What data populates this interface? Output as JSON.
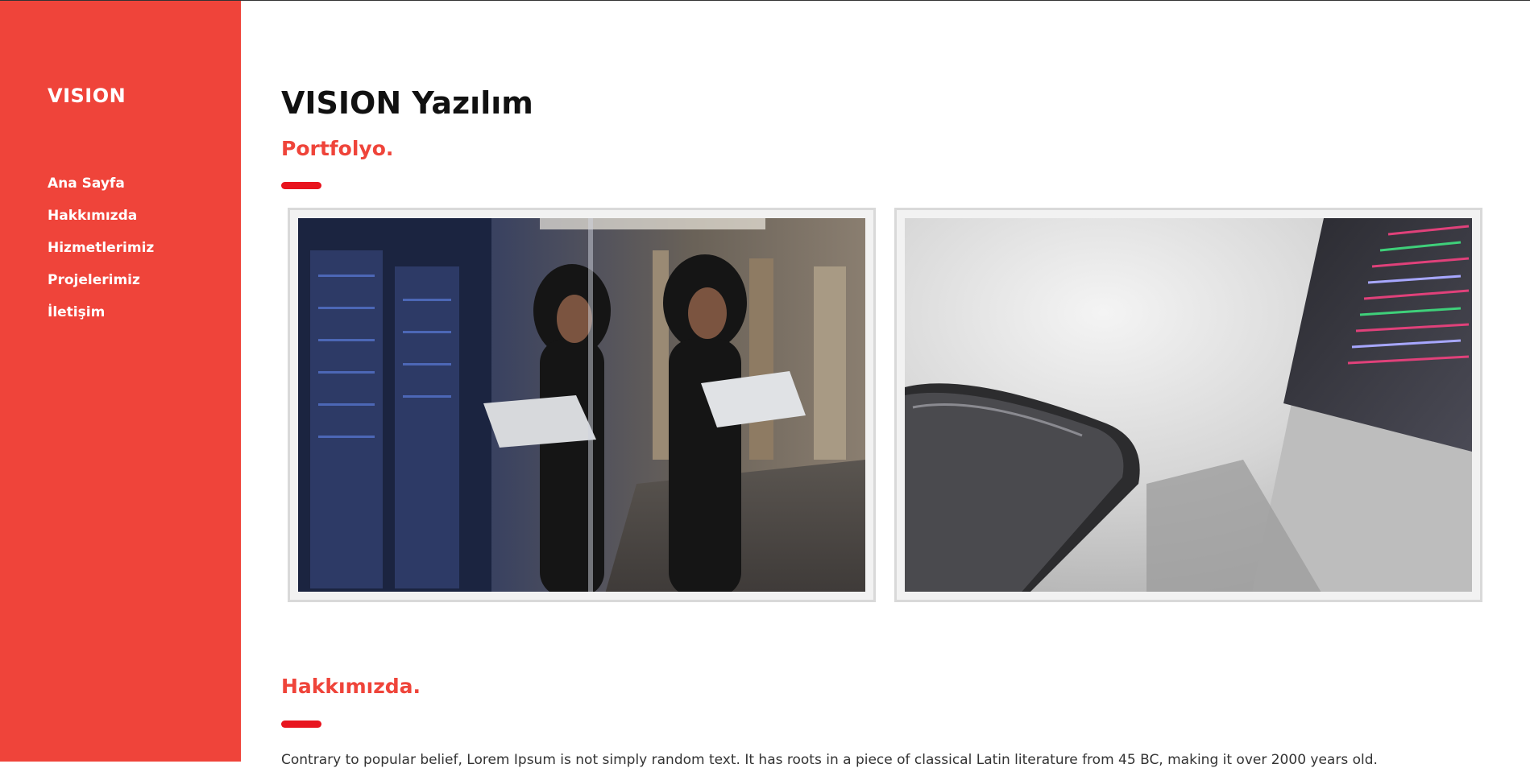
{
  "sidebar": {
    "brand": "VISION",
    "items": [
      {
        "label": "Ana Sayfa"
      },
      {
        "label": "Hakkımızda"
      },
      {
        "label": "Hizmetlerimiz"
      },
      {
        "label": "Projelerimiz"
      },
      {
        "label": "İletişim"
      }
    ]
  },
  "main": {
    "title": "VISION Yazılım",
    "portfolio": {
      "heading": "Portfolyo.",
      "images": [
        "woman-with-laptop-server-room-photo",
        "phone-on-laptop-photo"
      ]
    },
    "about": {
      "heading": "Hakkımızda.",
      "text": "Contrary to popular belief, Lorem Ipsum is not simply random text. It has roots in a piece of classical Latin literature from 45 BC, making it over 2000 years old."
    }
  },
  "colors": {
    "accent": "#ef443a",
    "underline": "#e8141e",
    "sidebar_text": "#ffffff",
    "title_text": "#111111"
  }
}
